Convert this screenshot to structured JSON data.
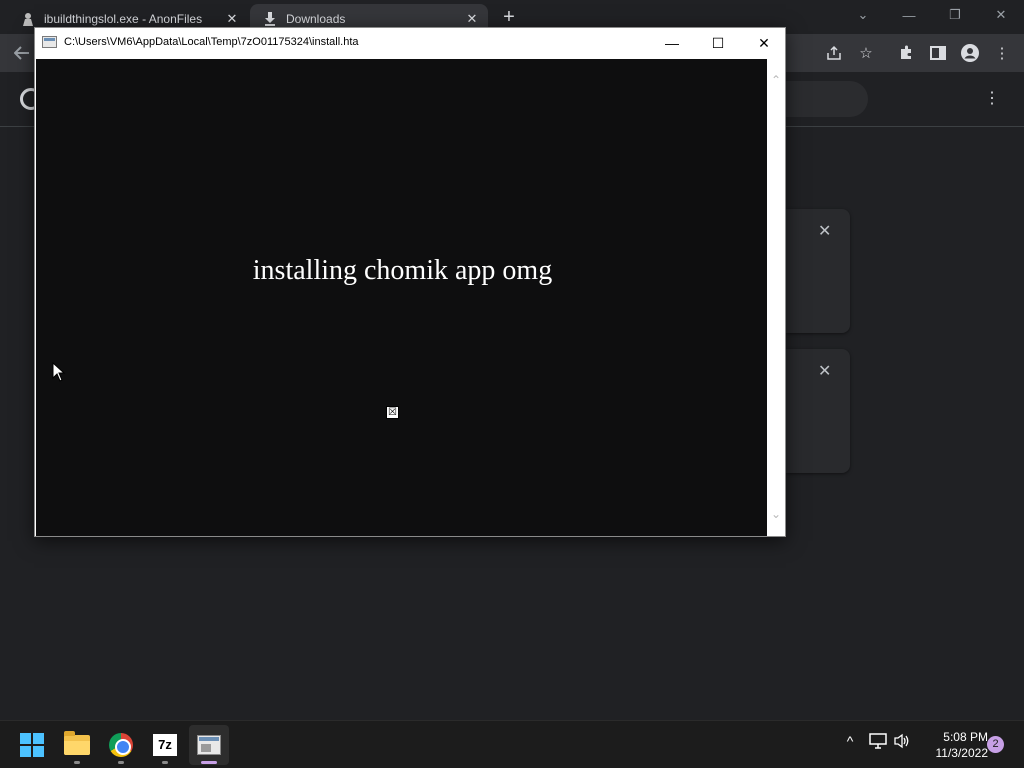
{
  "browser": {
    "tabs": [
      {
        "label": "ibuildthingslol.exe - AnonFiles",
        "icon": "anonfiles-icon"
      },
      {
        "label": "Downloads",
        "icon": "download-icon"
      }
    ],
    "new_tab": "+",
    "window_controls": {
      "dropdown": "⌄",
      "minimize": "—",
      "maximize": "❐",
      "close": "✕"
    },
    "toolbar_icons": [
      "back-icon",
      "share-icon",
      "star-icon",
      "extensions-icon",
      "sidepanel-icon",
      "profile-icon",
      "menu-icon"
    ],
    "downloads_page": {
      "more_icon": "⋮",
      "cards": [
        {
          "close": "✕"
        },
        {
          "close": "✕"
        }
      ]
    }
  },
  "hta_window": {
    "title": "C:\\Users\\VM6\\AppData\\Local\\Temp\\7zO01175324\\install.hta",
    "minimize": "—",
    "maximize": "☐",
    "close": "✕",
    "heading": "installing chomik app omg",
    "broken_image_glyph": "☒",
    "scroll_up": "⌃",
    "scroll_down": "⌄"
  },
  "taskbar": {
    "apps": [
      "start",
      "file-explorer",
      "chrome",
      "7zip",
      "hta-window"
    ],
    "sevenz_label": "7z",
    "clock": {
      "time": "5:08 PM",
      "date": "11/3/2022"
    },
    "notifications": "2",
    "tray": {
      "chevron": "^",
      "network": "🖥",
      "volume": "🔊"
    }
  },
  "colors": {
    "accent": "#c7a0e6",
    "hta_background": "#0e0e0f",
    "chrome_background": "#202124"
  }
}
